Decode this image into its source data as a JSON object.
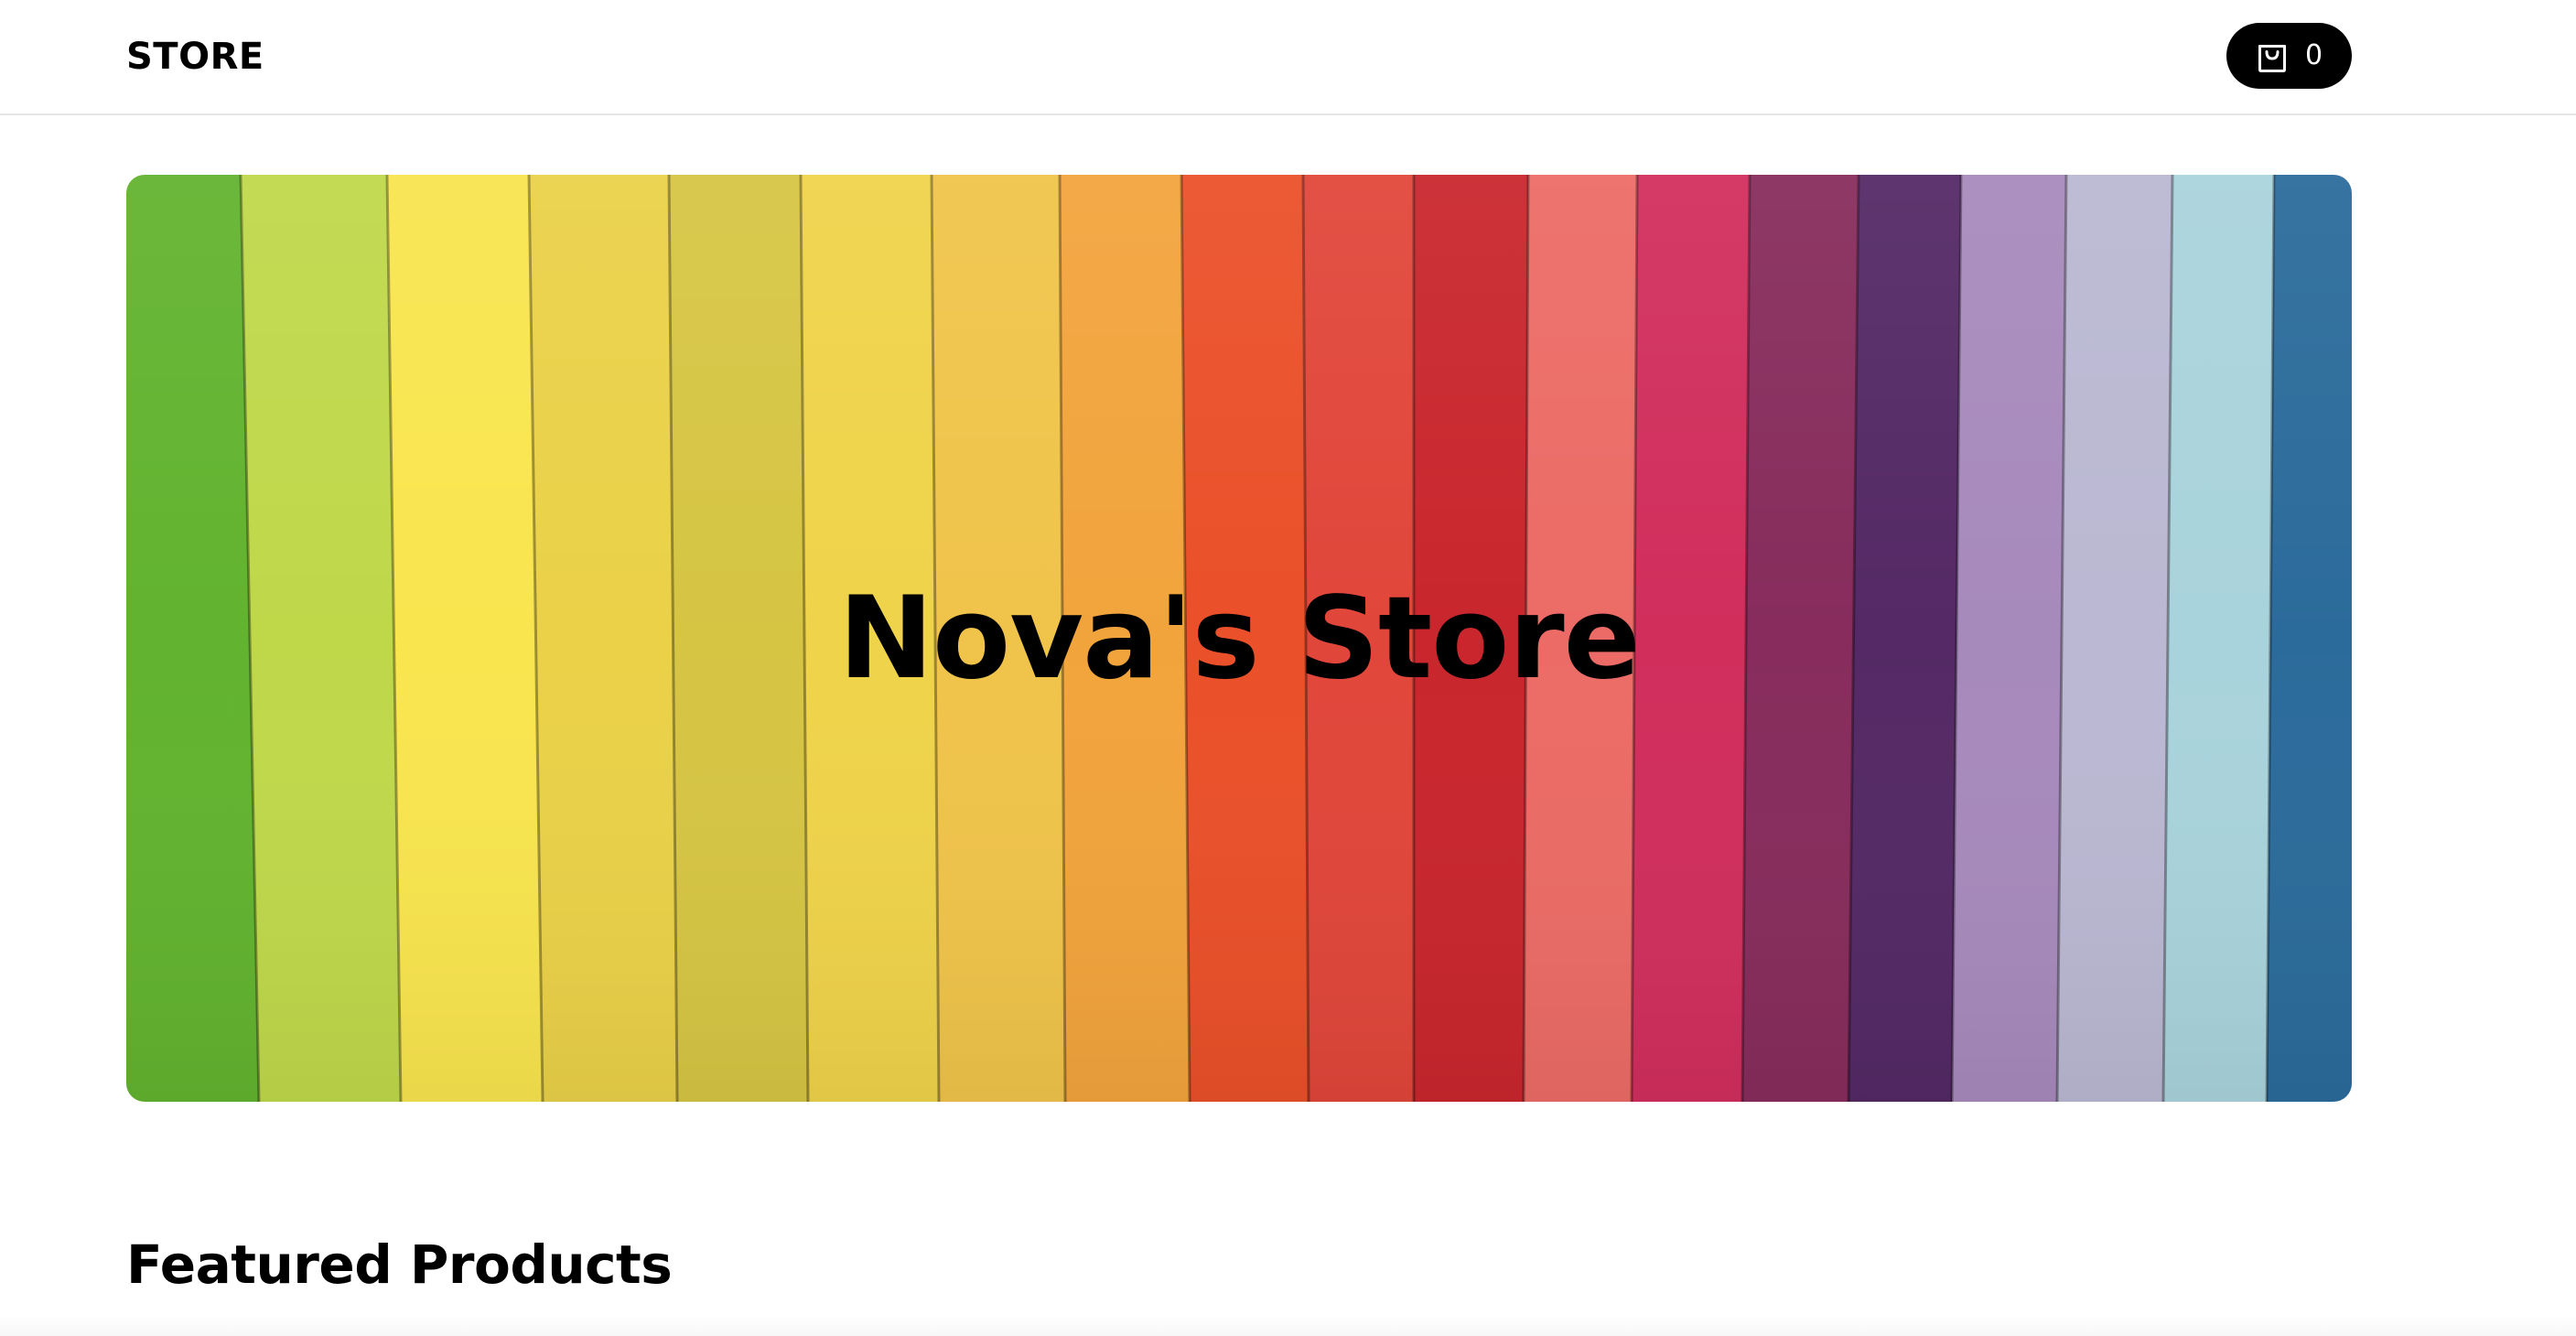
{
  "header": {
    "brand": "STORE",
    "cart": {
      "icon": "shopping-bag-icon",
      "count": "0",
      "background": "#000000"
    }
  },
  "hero": {
    "title": "Nova's Store",
    "stripe_colors": [
      "#62b32f",
      "#bfd84a",
      "#f9e54e",
      "#ead148",
      "#d6c543",
      "#efd34a",
      "#f0c44a",
      "#f2a43c",
      "#ea5029",
      "#e1463a",
      "#c9262d",
      "#ec6b66",
      "#d12e5c",
      "#872c5c",
      "#542965",
      "#a78abc",
      "#bab8d2",
      "#a9d3dc",
      "#2b6b9b"
    ]
  },
  "featured": {
    "title": "Featured Products"
  }
}
